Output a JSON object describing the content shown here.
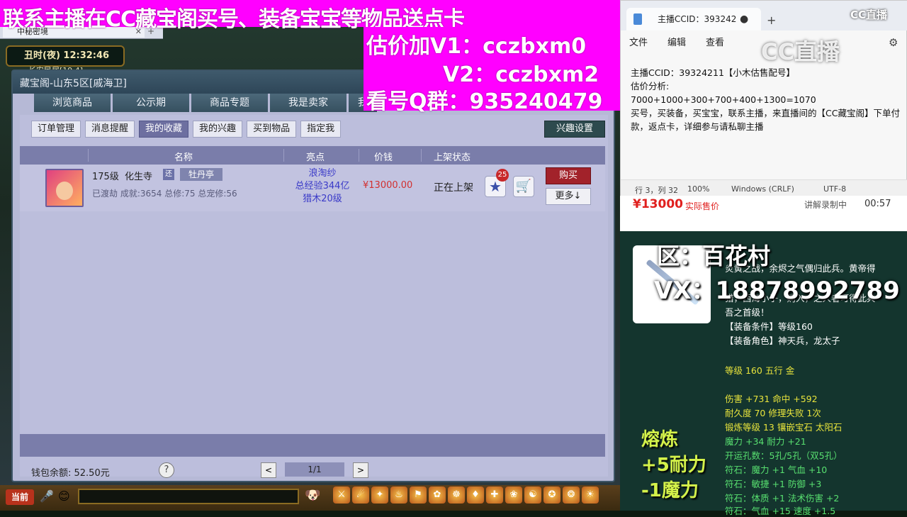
{
  "browser": {
    "tab_title": "中秘密境",
    "tab_close": "✕",
    "tab_add": "+"
  },
  "game": {
    "time": "丑时(夜)  12:32:46",
    "location": "长安民居[19,4]"
  },
  "window": {
    "title": "藏宝阁-山东5区[戚海卫]",
    "nav_tabs": [
      "浏览商品",
      "公示期",
      "商品专题",
      "我是卖家",
      "我"
    ],
    "sub_tabs": [
      "订单管理",
      "消息提醒",
      "我的收藏",
      "我的兴趣",
      "买到物品",
      "指定我"
    ],
    "interest_button": "兴趣设置",
    "columns": [
      "名称",
      "亮点",
      "价钱",
      "上架状态"
    ],
    "row": {
      "level": "175级",
      "sect": "化生寺",
      "badge": "还",
      "server_tag": "牡丹亭",
      "info": "已渡劫 成就:3654 总修:75 总宠修:56",
      "highlight_1": "浪淘纱",
      "highlight_2": "总经验344亿",
      "highlight_3": "猎木20级",
      "price": "¥13000.00",
      "status": "正在上架",
      "star_count": "25",
      "buy": "购买",
      "more": "更多↓"
    },
    "wallet": "钱包余额: 52.50元",
    "page": "1/1",
    "help": "?",
    "prev": "<",
    "next": ">"
  },
  "bottom": {
    "current_label": "当前",
    "hotbar": [
      "⚔",
      "☄",
      "✦",
      "♨",
      "⚑",
      "✿",
      "☸",
      "♦",
      "✚",
      "❀",
      "☯",
      "✪",
      "❂",
      "☀",
      "✉",
      "⚙"
    ]
  },
  "overlay": {
    "top_line": "联系主播在CC藏宝阁买号、装备宝宝等物品送点卡",
    "line1": "估价加V1：cczbxm0",
    "line2": "V2：cczbxm2",
    "line3": "看号Q群：935240479"
  },
  "notepad": {
    "tab_title": "主播CCID：393242",
    "menu": [
      "文件",
      "编辑",
      "查看"
    ],
    "line1": "主播CCID：39324211【小木估售配号】",
    "line2": "估价分析:",
    "line3": "7000+1000+300+700+400+1300=1070",
    "line4": "买号，买装备，买宝宝，联系主播，来直播间的【CC藏宝阁】下单付款，返点卡，详细参与请私聊主播",
    "status_pos": "行 3，列 32",
    "status_zoom": "100%",
    "status_eol": "Windows (CRLF)",
    "status_enc": "UTF-8"
  },
  "cc_logo": "CC直播",
  "cc_watermark": "CC直播",
  "strip": {
    "price": "¥13000",
    "label": "实际售价",
    "status": "讲解录制中",
    "time": "00:57"
  },
  "item": {
    "region": "区：百花村",
    "vx": "VX：18878992789",
    "desc1": "炎黄之战，余烬之气偶归此兵。黄帝得",
    "desc2": "猎，西海小子，购入，之人者可得此兵-",
    "desc3": "吾之首级！",
    "cond": "【装备条件】等级160",
    "role": "【装备角色】神天兵，龙太子",
    "level": "等级 160  五行 金",
    "attr1": "伤害 +731 命中 +592",
    "attr2": "耐久度 70  修理失败 1次",
    "attr3": "锻炼等级 13  镶嵌宝石 太阳石",
    "attr4": "魔力 +34 耐力 +21",
    "attr5": "开运孔数：5孔/5孔（双5孔）",
    "attr6": "符石：魔力 +1 气血 +10",
    "attr7": "符石：敏捷 +1 防御 +3",
    "attr8": "符石：体质 +1 法术伤害 +2",
    "attr9": "符石：气血 +15 速度 +1.5",
    "forge1": "熔炼",
    "forge2": "+5耐力",
    "forge3": "-1魔力"
  },
  "colors": {
    "accent_magenta": "#ff00ff",
    "panel_green": "#14352e",
    "price_red": "#d23030"
  }
}
